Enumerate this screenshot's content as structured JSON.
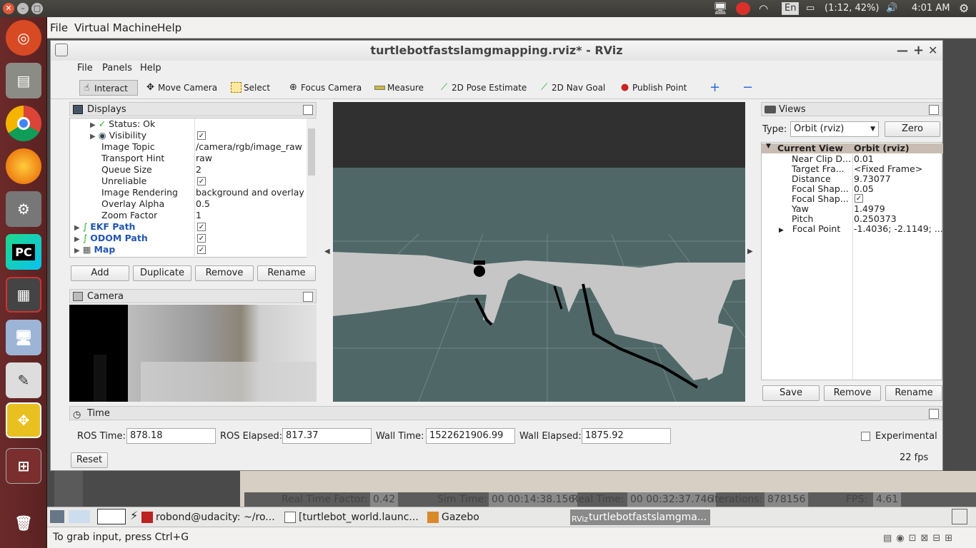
{
  "top_panel": {
    "lang": "En",
    "battery": "(1:12, 42%)",
    "clock": "4:01 AM"
  },
  "vm_menu": [
    "File",
    "Virtual Machine",
    "Help"
  ],
  "vm_status": "To grab input, press Ctrl+G",
  "guest_taskbar": [
    {
      "label": "robond@udacity: ~/ro...",
      "icon": "terminal-icon"
    },
    {
      "label": "[turtlebot_world.launc...",
      "icon": "editor-icon"
    },
    {
      "label": "Gazebo",
      "icon": "gazebo-icon"
    },
    {
      "label": "turtlebotfastslamgma...",
      "icon": "rviz-icon"
    }
  ],
  "gazebo_bar": {
    "real_time_factor_label": "Real Time Factor:",
    "real_time_factor": "0.42",
    "sim_time_label": "Sim Time:",
    "sim_time": "00 00:14:38.156",
    "real_time_label": "Real Time:",
    "real_time": "00 00:32:37.746",
    "iterations_label": "Iterations:",
    "iterations": "878156",
    "fps_label": "FPS:",
    "fps": "4.61"
  },
  "rviz": {
    "title": "turtlebotfastslamgmapping.rviz* - RViz",
    "menu": [
      "File",
      "Panels",
      "Help"
    ],
    "tools": [
      "Interact",
      "Move Camera",
      "Select",
      "Focus Camera",
      "Measure",
      "2D Pose Estimate",
      "2D Nav Goal",
      "Publish Point"
    ],
    "displays": {
      "title": "Displays",
      "rows": [
        {
          "name": "Status: Ok",
          "value": ""
        },
        {
          "name": "Visibility",
          "value": "✓"
        },
        {
          "name": "Image Topic",
          "value": "/camera/rgb/image_raw"
        },
        {
          "name": "Transport Hint",
          "value": "raw"
        },
        {
          "name": "Queue Size",
          "value": "2"
        },
        {
          "name": "Unreliable",
          "value": "✓"
        },
        {
          "name": "Image Rendering",
          "value": "background and overlay"
        },
        {
          "name": "Overlay Alpha",
          "value": "0.5"
        },
        {
          "name": "Zoom Factor",
          "value": "1"
        },
        {
          "name": "EKF Path",
          "value": "✓"
        },
        {
          "name": "ODOM Path",
          "value": "✓"
        },
        {
          "name": "Map",
          "value": "✓"
        }
      ],
      "buttons": [
        "Add",
        "Duplicate",
        "Remove",
        "Rename"
      ]
    },
    "camera": {
      "title": "Camera"
    },
    "views": {
      "title": "Views",
      "type_label": "Type:",
      "type_value": "Orbit (rviz)",
      "zero_label": "Zero",
      "header": {
        "name": "Current View",
        "value": "Orbit (rviz)"
      },
      "rows": [
        {
          "name": "Near Clip D...",
          "value": "0.01"
        },
        {
          "name": "Target Fra...",
          "value": "<Fixed Frame>"
        },
        {
          "name": "Distance",
          "value": "9.73077"
        },
        {
          "name": "Focal Shap...",
          "value": "0.05"
        },
        {
          "name": "Focal Shap...",
          "value": "✓"
        },
        {
          "name": "Yaw",
          "value": "1.4979"
        },
        {
          "name": "Pitch",
          "value": "0.250373"
        },
        {
          "name": "Focal Point",
          "value": "-1.4036; -2.1149; ..."
        }
      ],
      "buttons": [
        "Save",
        "Remove",
        "Rename"
      ]
    },
    "time": {
      "title": "Time",
      "ros_time_label": "ROS Time:",
      "ros_time": "878.18",
      "ros_elapsed_label": "ROS Elapsed:",
      "ros_elapsed": "817.37",
      "wall_time_label": "Wall Time:",
      "wall_time": "1522621906.99",
      "wall_elapsed_label": "Wall Elapsed:",
      "wall_elapsed": "1875.92",
      "experimental_label": "Experimental",
      "reset_label": "Reset",
      "fps": "22 fps"
    }
  }
}
